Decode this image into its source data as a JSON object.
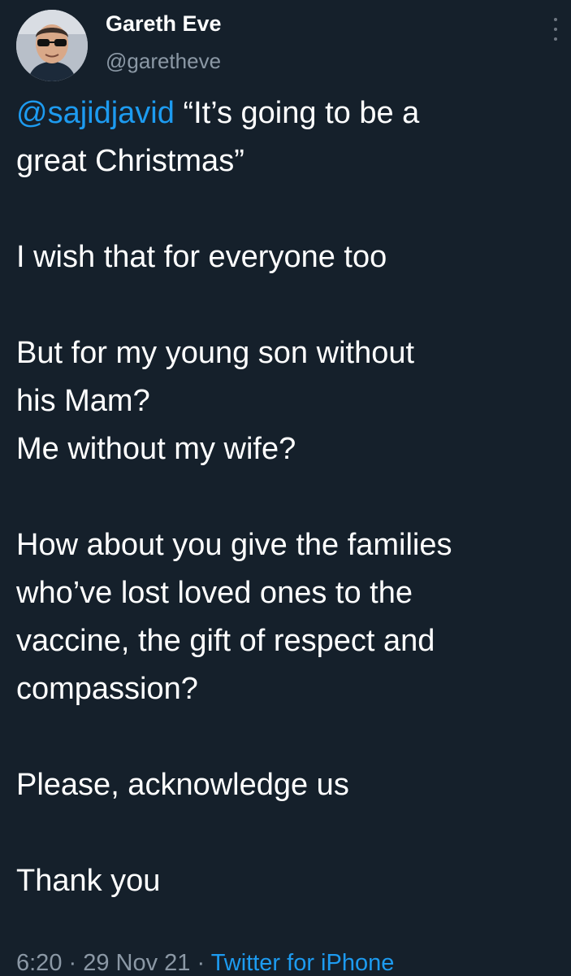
{
  "author": {
    "display_name": "Gareth Eve",
    "handle": "@garetheve"
  },
  "tweet": {
    "mention": "@sajidjavid",
    "line1_rest": " “It’s going to be a",
    "line2": "great Christmas”",
    "line3": "I wish that for everyone too",
    "line4": "But for my young son without",
    "line5": "his Mam?",
    "line6": "Me without my wife?",
    "line7": "How about you give the families",
    "line8": "who’ve lost loved ones to the",
    "line9": "vaccine, the gift of respect and",
    "line10": "compassion?",
    "line11": "Please, acknowledge us",
    "line12": "Thank you"
  },
  "meta": {
    "time": "6:20",
    "sep1": " · ",
    "date": "29 Nov 21",
    "sep2": " · ",
    "source": "Twitter for iPhone"
  },
  "icons": {
    "more": "more-vertical-icon"
  },
  "colors": {
    "background": "#15202b",
    "link": "#1d9bf0",
    "secondary_text": "#8b98a5"
  }
}
